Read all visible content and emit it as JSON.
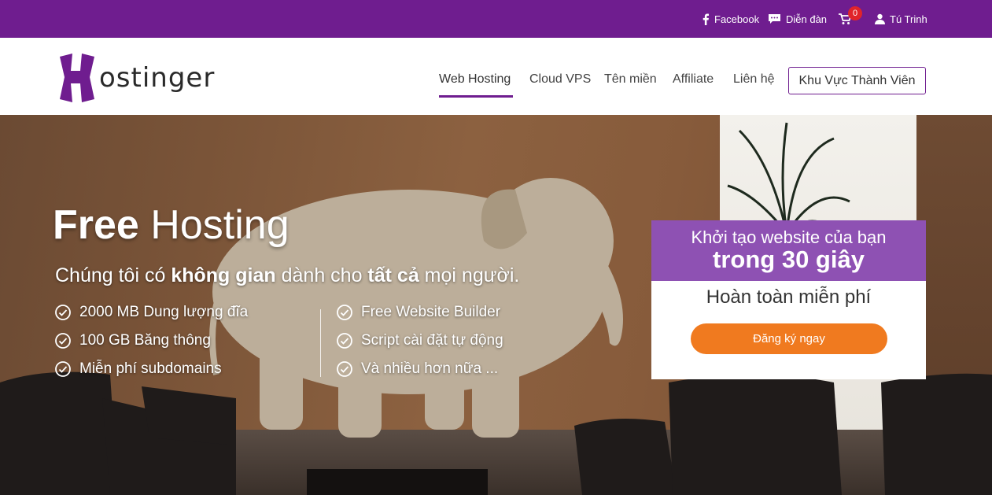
{
  "topbar": {
    "facebook_label": "Facebook",
    "forum_label": "Diễn đàn",
    "cart_count": "0",
    "user_label": "Tú Trinh"
  },
  "header": {
    "logo_text": "ostinger",
    "nav": [
      {
        "label": "Web Hosting",
        "active": true
      },
      {
        "label": "Cloud VPS"
      },
      {
        "label": "Tên miền"
      },
      {
        "label": "Affiliate"
      },
      {
        "label": "Liên hệ"
      }
    ],
    "member_button": "Khu Vực Thành Viên"
  },
  "hero": {
    "title_bold": "Free",
    "title_light": "Hosting",
    "subtitle_pre": "Chúng tôi có ",
    "subtitle_bold1": "không gian",
    "subtitle_mid": " dành cho ",
    "subtitle_bold2": "tất cả",
    "subtitle_post": " mọi người.",
    "features_left": [
      "2000 MB Dung lượng đĩa",
      "100 GB Băng thông",
      "Miễn phí subdomains"
    ],
    "features_right": [
      "Free Website Builder",
      "Script cài đặt tự động",
      "Và nhiều hơn nữa ..."
    ]
  },
  "signup": {
    "line1": "Khởi tạo website của bạn",
    "line2": "trong 30 giây",
    "free_text": "Hoàn toàn miễn phí",
    "button": "Đăng ký ngay"
  },
  "colors": {
    "brand_purple": "#6f1d8f",
    "signup_purple": "#8e51b3",
    "cta_orange": "#f07a1f",
    "badge_red": "#e0242a"
  }
}
